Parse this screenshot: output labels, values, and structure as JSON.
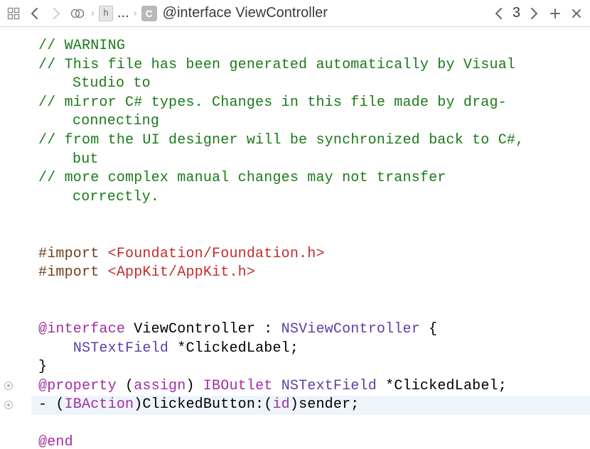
{
  "toolbar": {
    "file_letter": "h",
    "ellipsis": "...",
    "class_letter": "C",
    "breadcrumb": "@interface ViewController",
    "count": "3"
  },
  "code": {
    "comment1": "// WARNING",
    "comment2a": "// This file has been generated automatically by Visual ",
    "comment2b": "Studio to",
    "comment3a": "// mirror C# types. Changes in this file made by drag-",
    "comment3b": "connecting",
    "comment4a": "// from the UI designer will be synchronized back to C#, ",
    "comment4b": "but",
    "comment5a": "// more complex manual changes may not transfer ",
    "comment5b": "correctly.",
    "import_kw": "#import",
    "import1_hdr": "<Foundation/Foundation.h>",
    "import2_hdr": "<AppKit/AppKit.h>",
    "at_interface": "@interface",
    "classname": "ViewController",
    "colon": " : ",
    "superclass": "NSViewController",
    "brace_open": " {",
    "ivar_type": "NSTextField",
    "ivar_rest": " *ClickedLabel;",
    "brace_close": "}",
    "at_property": "@property",
    "prop_open": " (",
    "assign_kw": "assign",
    "prop_close": ") ",
    "iboutlet": "IBOutlet",
    "prop_type": "NSTextField",
    "prop_rest": " *ClickedLabel;",
    "action_dash": "- (",
    "ibaction": "IBAction",
    "action_mid": ")ClickedButton:(",
    "id_kw": "id",
    "action_end": ")sender;",
    "at_end": "@end"
  }
}
